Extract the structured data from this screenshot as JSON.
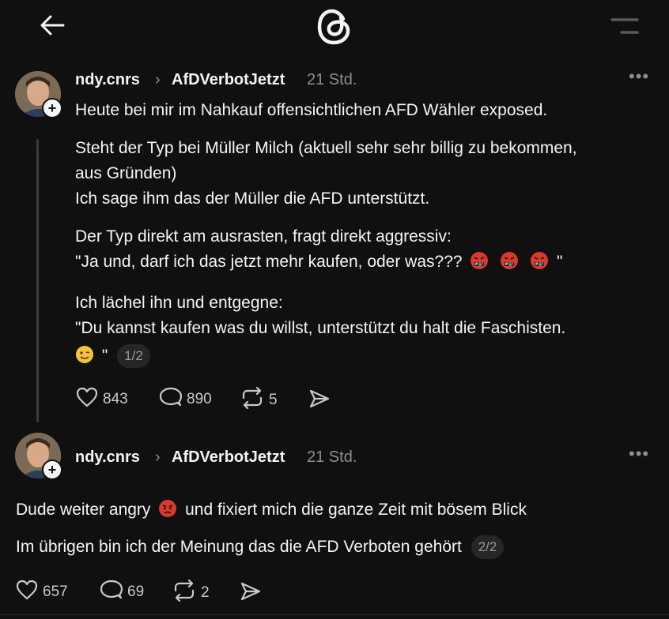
{
  "header": {
    "back_icon": "arrow-left-icon",
    "logo_icon": "threads-logo",
    "menu_icon": "menu-icon"
  },
  "posts": [
    {
      "username": "ndy.cnrs",
      "tag": "AfDVerbotJetzt",
      "time": "21 Std.",
      "lines": [
        "Heute bei mir im Nahkauf offensichtlichen AFD Wähler exposed.",
        "Steht der Typ bei Müller Milch (aktuell sehr sehr billig zu bekommen,",
        "aus Gründen)",
        "Ich sage ihm das der Müller die AFD unterstützt.",
        "Der Typ direkt am ausrasten, fragt direkt aggressiv:",
        "\"Ja und, darf ich das jetzt mehr kaufen, oder was???",
        "\"",
        "Ich lächel ihn und entgegne:",
        "\"Du kannst kaufen was du willst, unterstützt du halt die Faschisten.",
        "\""
      ],
      "page_indicator": "1/2",
      "likes": "843",
      "comments": "890",
      "reposts": "5"
    },
    {
      "username": "ndy.cnrs",
      "tag": "AfDVerbotJetzt",
      "time": "21 Std.",
      "lines": [
        "Dude weiter angry",
        "und fixiert mich die ganze Zeit mit bösem Blick",
        "Im übrigen bin ich der Meinung das die AFD Verboten gehört"
      ],
      "page_indicator": "2/2",
      "likes": "657",
      "comments": "69",
      "reposts": "2"
    }
  ],
  "colors": {
    "background": "#101010",
    "text": "#f3f5f7",
    "muted": "#8e8e8e"
  }
}
